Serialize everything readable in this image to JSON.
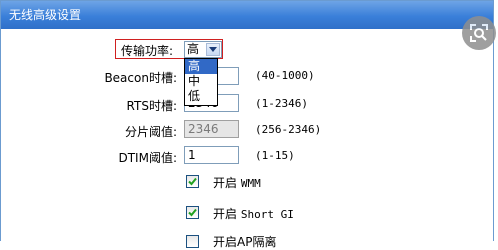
{
  "window": {
    "title": "无线高级设置"
  },
  "form": {
    "tx_power": {
      "label": "传输功率:",
      "selected": "高",
      "options": [
        "高",
        "中",
        "低"
      ]
    },
    "beacon": {
      "label": "Beacon时槽:",
      "value": "",
      "range": "(40-1000)"
    },
    "rts": {
      "label": "RTS时槽:",
      "value": "2346",
      "range": "(1-2346)"
    },
    "fragment": {
      "label": "分片阈值:",
      "value": "2346",
      "range": "(256-2346)"
    },
    "dtim": {
      "label": "DTIM阈值:",
      "value": "1",
      "range": "(1-15)"
    },
    "wmm": {
      "prefix": "开启",
      "name": "WMM",
      "checked": true
    },
    "short_gi": {
      "prefix": "开启",
      "name": "Short GI",
      "checked": true
    },
    "ap_isolation": {
      "label": "开启AP隔离",
      "checked": false
    }
  },
  "colors": {
    "titlebar": "#3a7fd9",
    "highlight_border": "#d02020",
    "selected_option": "#3169c6"
  },
  "icons": {
    "lens": "lens-search-icon",
    "dropdown": "chevron-down-icon",
    "check": "checkmark-icon"
  }
}
